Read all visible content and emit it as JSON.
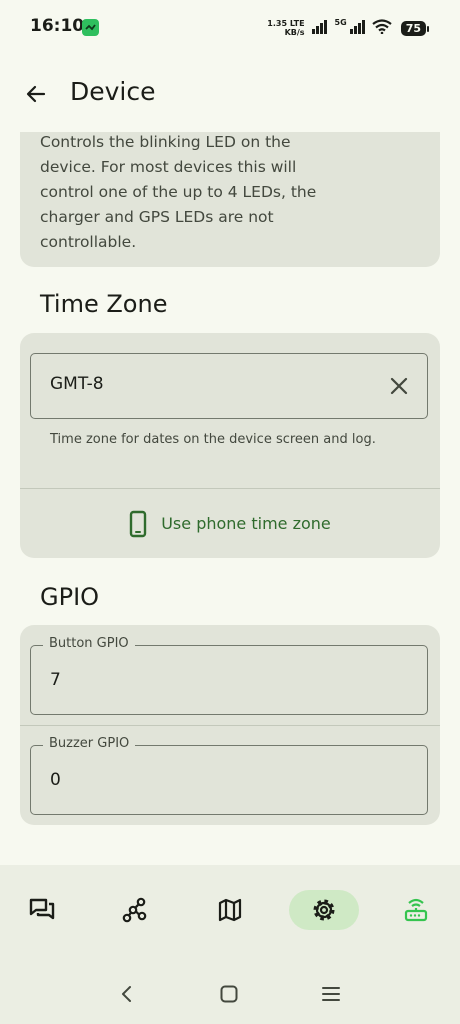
{
  "status_bar": {
    "time": "16:10",
    "net_speed_value": "1.35",
    "net_speed_unit": "KB/s",
    "lte_label": "LTE",
    "fiveg_label": "5G",
    "battery": "75"
  },
  "header": {
    "title": "Device"
  },
  "led_section": {
    "description": "Controls the blinking LED on the device. For most devices this will control one of the up to 4 LEDs, the charger and GPS LEDs are not controllable."
  },
  "time_zone": {
    "title": "Time Zone",
    "value": "GMT-8",
    "helper": "Time zone for dates on the device screen and log.",
    "phone_button_label": "Use phone time zone"
  },
  "gpio": {
    "title": "GPIO",
    "button_label": "Button GPIO",
    "button_value": "7",
    "buzzer_label": "Buzzer GPIO",
    "buzzer_value": "0"
  },
  "bottom_nav": {
    "items": [
      {
        "icon": "messages-icon"
      },
      {
        "icon": "nodes-icon"
      },
      {
        "icon": "map-icon"
      },
      {
        "icon": "settings-icon",
        "active": true
      },
      {
        "icon": "router-connected-icon"
      }
    ]
  },
  "colors": {
    "accent": "#2f6b2d",
    "card": "#e1e4d9",
    "active_nav": "#cfe9c5",
    "connected": "#35c44f"
  }
}
